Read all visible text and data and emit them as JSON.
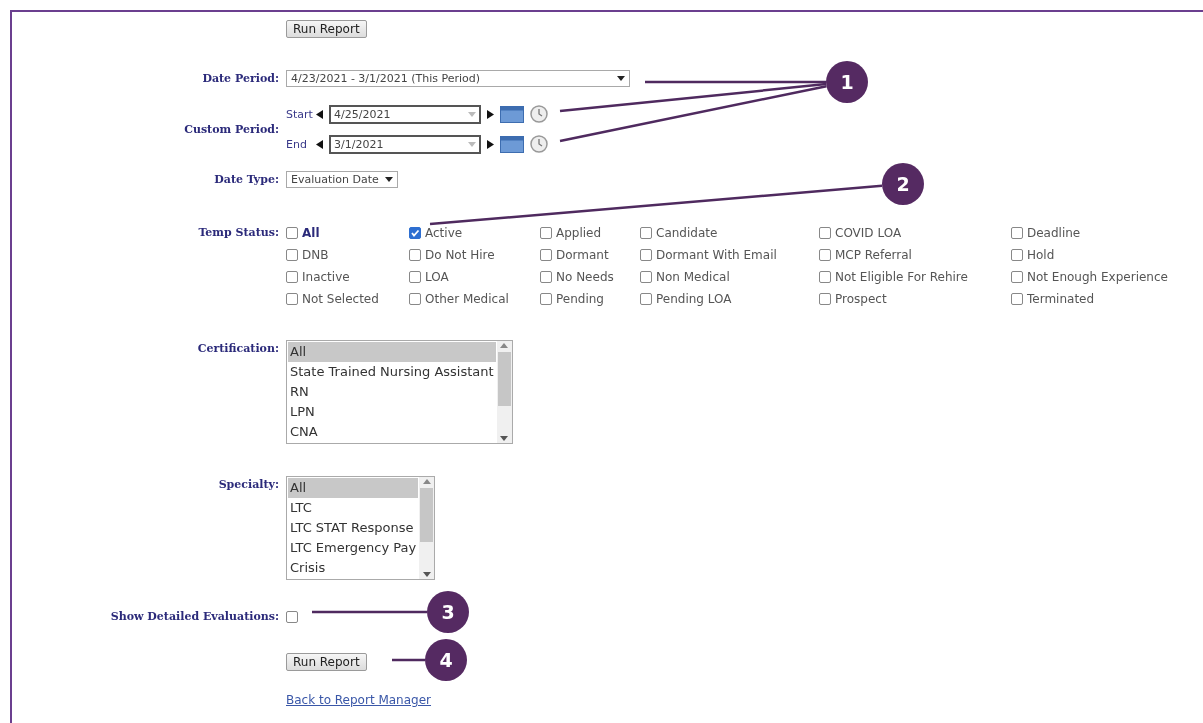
{
  "top_button": {
    "label": "Run Report"
  },
  "date_period": {
    "label": "Date Period:",
    "value": "4/23/2021 - 3/1/2021 (This Period)"
  },
  "custom_period": {
    "label": "Custom Period:",
    "start": {
      "label": "Start",
      "value": "4/25/2021"
    },
    "end": {
      "label": "End",
      "value": "3/1/2021"
    }
  },
  "date_type": {
    "label": "Date Type:",
    "value": "Evaluation Date"
  },
  "temp_status": {
    "label": "Temp Status:",
    "options": [
      {
        "label": "All",
        "checked": false,
        "bold": true
      },
      {
        "label": "Active",
        "checked": true,
        "bold": false
      },
      {
        "label": "Applied",
        "checked": false,
        "bold": false
      },
      {
        "label": "Candidate",
        "checked": false,
        "bold": false
      },
      {
        "label": "COVID LOA",
        "checked": false,
        "bold": false
      },
      {
        "label": "Deadline",
        "checked": false,
        "bold": false
      },
      {
        "label": "DNB",
        "checked": false,
        "bold": false
      },
      {
        "label": "Do Not Hire",
        "checked": false,
        "bold": false
      },
      {
        "label": "Dormant",
        "checked": false,
        "bold": false
      },
      {
        "label": "Dormant With Email",
        "checked": false,
        "bold": false
      },
      {
        "label": "MCP Referral",
        "checked": false,
        "bold": false
      },
      {
        "label": "Hold",
        "checked": false,
        "bold": false
      },
      {
        "label": "Inactive",
        "checked": false,
        "bold": false
      },
      {
        "label": "LOA",
        "checked": false,
        "bold": false
      },
      {
        "label": "No Needs",
        "checked": false,
        "bold": false
      },
      {
        "label": "Non Medical",
        "checked": false,
        "bold": false
      },
      {
        "label": "Not Eligible For Rehire",
        "checked": false,
        "bold": false
      },
      {
        "label": "Not Enough Experience",
        "checked": false,
        "bold": false
      },
      {
        "label": "Not Selected",
        "checked": false,
        "bold": false
      },
      {
        "label": "Other Medical",
        "checked": false,
        "bold": false
      },
      {
        "label": "Pending",
        "checked": false,
        "bold": false
      },
      {
        "label": "Pending LOA",
        "checked": false,
        "bold": false
      },
      {
        "label": "Prospect",
        "checked": false,
        "bold": false
      },
      {
        "label": "Terminated",
        "checked": false,
        "bold": false
      }
    ]
  },
  "certification": {
    "label": "Certification:",
    "items": [
      {
        "label": "All",
        "selected": true
      },
      {
        "label": "State Trained Nursing Assistant",
        "selected": false
      },
      {
        "label": "RN",
        "selected": false
      },
      {
        "label": "LPN",
        "selected": false
      },
      {
        "label": "CNA",
        "selected": false
      }
    ]
  },
  "specialty": {
    "label": "Specialty:",
    "items": [
      {
        "label": "All",
        "selected": true
      },
      {
        "label": "LTC",
        "selected": false
      },
      {
        "label": "LTC STAT Response",
        "selected": false
      },
      {
        "label": "LTC Emergency Pay",
        "selected": false
      },
      {
        "label": "Crisis",
        "selected": false
      }
    ]
  },
  "show_detailed": {
    "label": "Show Detailed Evaluations:",
    "checked": false
  },
  "bottom_button": {
    "label": "Run Report"
  },
  "back_link": {
    "label": "Back to Report Manager"
  },
  "callouts": [
    {
      "label": "1"
    },
    {
      "label": "2"
    },
    {
      "label": "3"
    },
    {
      "label": "4"
    }
  ]
}
